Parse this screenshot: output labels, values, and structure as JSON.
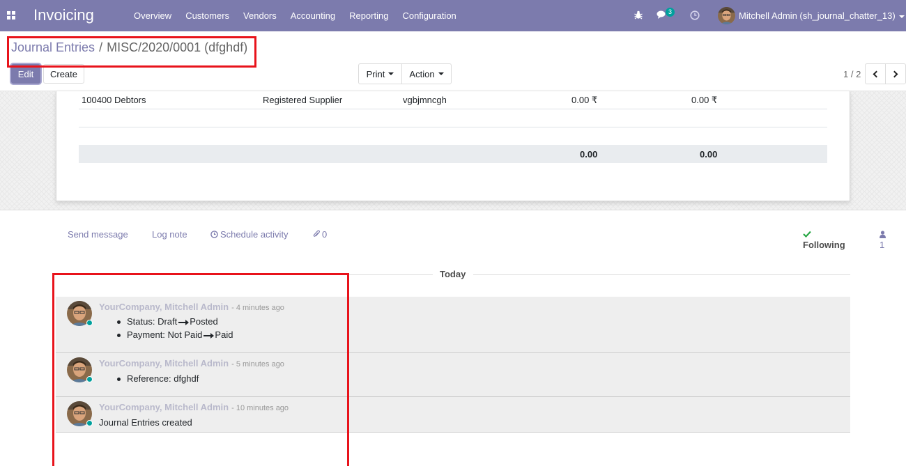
{
  "navbar": {
    "app_name": "Invoicing",
    "menu": [
      "Overview",
      "Customers",
      "Vendors",
      "Accounting",
      "Reporting",
      "Configuration"
    ],
    "messages_count": "3",
    "user_name": "Mitchell Admin (sh_journal_chatter_13)",
    "color": "#7c7bad"
  },
  "breadcrumb": {
    "parent": "Journal Entries",
    "separator": "/",
    "current": "MISC/2020/0001 (dfghdf)"
  },
  "buttons": {
    "edit": "Edit",
    "create": "Create",
    "print": "Print",
    "action": "Action"
  },
  "pager": {
    "value": "1 / 2"
  },
  "journal_line": {
    "account": "100400 Debtors",
    "partner": "Registered Supplier",
    "label": "vgbjmncgh",
    "debit": "0.00 ₹",
    "credit": "0.00 ₹"
  },
  "totals": {
    "debit": "0.00",
    "credit": "0.00"
  },
  "chatter": {
    "send_message": "Send message",
    "log_note": "Log note",
    "schedule_activity": "Schedule activity",
    "attachments_count": "0",
    "following": "Following",
    "followers_count": "1",
    "today": "Today",
    "messages": [
      {
        "author": "YourCompany, Mitchell Admin",
        "date": "- 4 minutes ago",
        "tracking": [
          {
            "field": "Status:",
            "old": "Draft",
            "new": "Posted"
          },
          {
            "field": "Payment:",
            "old": "Not Paid",
            "new": "Paid"
          }
        ]
      },
      {
        "author": "YourCompany, Mitchell Admin",
        "date": "- 5 minutes ago",
        "tracking": [
          {
            "field": "Reference:",
            "new": "dfghdf"
          }
        ]
      },
      {
        "author": "YourCompany, Mitchell Admin",
        "date": "- 10 minutes ago",
        "body": "Journal Entries created"
      }
    ]
  },
  "colors": {
    "highlight_box": "#e8131b",
    "presence": "#00a09d",
    "following_check": "#28a745"
  }
}
